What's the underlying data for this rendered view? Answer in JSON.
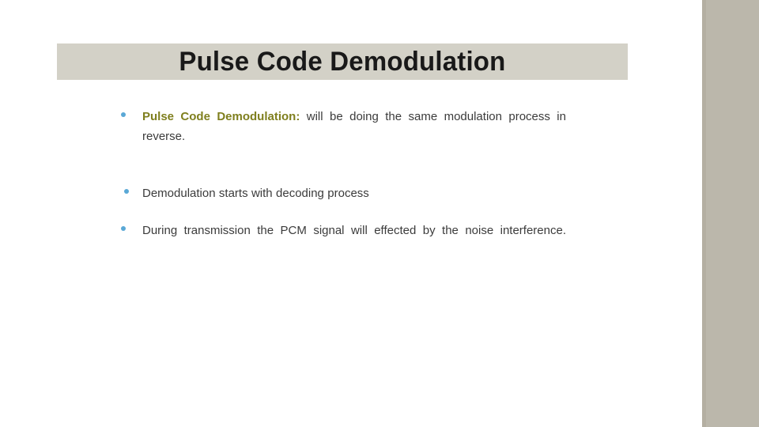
{
  "slide": {
    "title": "Pulse Code Demodulation",
    "title_band_color": "#d3d1c7",
    "title_text_color": "#191919",
    "background_color": "#ffffff",
    "accent_panel_color": "#bbb7ab",
    "bullet_marker_color": "#5aa8d6",
    "body_text_color": "#3b3b3b",
    "highlight_color": "#7f7f1e",
    "bullets": [
      {
        "lead": "Pulse Code Demodulation:",
        "text": " will be doing the same modulation process in reverse."
      },
      {
        "lead": "",
        "text": "Demodulation starts with decoding process"
      },
      {
        "lead": "",
        "text": "During transmission the PCM signal will effected by the noise interference."
      }
    ]
  }
}
